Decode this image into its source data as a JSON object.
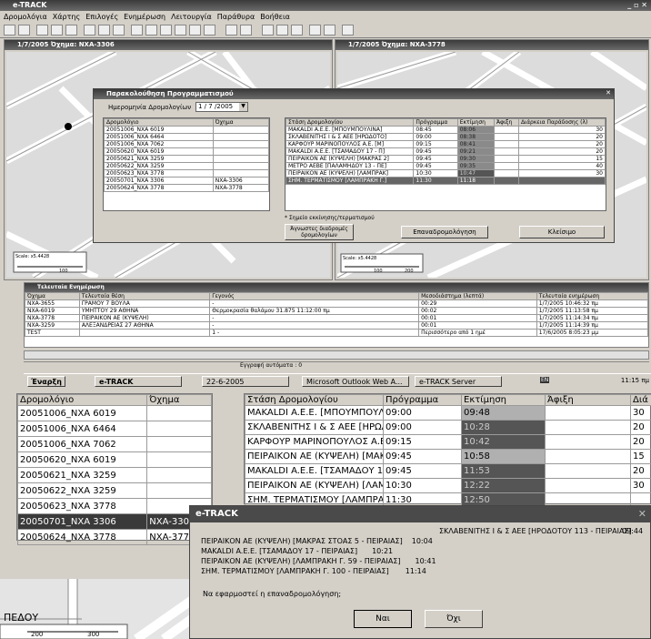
{
  "app": {
    "title": "e-TRACK",
    "menu": [
      "Δρομολόγια",
      "Χάρτης",
      "Επιλογές",
      "Ενημέρωση",
      "Λειτουργία",
      "Παράθυρα",
      "Βοήθεια"
    ]
  },
  "map_left": {
    "title": "1/7/2005 Όχημα: NXA-3306",
    "scale": "Scale: x5.4428",
    "scale_tick": "100"
  },
  "map_right": {
    "title": "1/7/2005 Όχημα: NXA-3778",
    "scale": "Scale: x5.4428",
    "scale_ticks": [
      "100",
      "200"
    ]
  },
  "schedule_dialog": {
    "title": "Παρακολούθηση Προγραμματισμού",
    "date_label": "Ημερομηνία Δρομολογίων",
    "date_value": "1 / 7 /2005",
    "left_headers": [
      "Δρομολόγιο",
      "Όχημα"
    ],
    "left_rows": [
      [
        "20051006_NXA 6019",
        ""
      ],
      [
        "20051006_NXA 6464",
        ""
      ],
      [
        "20051006_NXA 7062",
        ""
      ],
      [
        "20050620_NXA 6019",
        ""
      ],
      [
        "20050621_NXA 3259",
        ""
      ],
      [
        "20050622_NXA 3259",
        ""
      ],
      [
        "20050623_NXA 3778",
        ""
      ],
      [
        "20050701_NXA 3306",
        "NXA-3306"
      ],
      [
        "20050624_NXA 3778",
        "NXA-3778"
      ]
    ],
    "right_headers": [
      "Στάση Δρομολογίου",
      "Πρόγραμμα",
      "Εκτίμηση",
      "Άφιξη",
      "Διάρκεια Παράδοσης (λ)"
    ],
    "right_rows": [
      [
        "MAKALDI A.E.E. [ΜΠΟΥΜΠΟΥΛΙΝΑ]",
        "08:45",
        "08:06",
        "",
        "30"
      ],
      [
        "ΣΚΛΑΒΕΝΙΤΗΣ Ι & Σ ΑΕΕ [ΗΡΩΔΟΤΟ]",
        "09:00",
        "08:38",
        "",
        "20"
      ],
      [
        "ΚΑΡΦΟΥΡ ΜΑΡΙΝΟΠΟΥΛΟΣ Α.Ε. [Μ]",
        "09:15",
        "08:41",
        "",
        "20"
      ],
      [
        "MAKALDI A.E.E. [ΤΣΑΜΑΔΟΥ 17 - Π]",
        "09:45",
        "09:21",
        "",
        "20"
      ],
      [
        "ΠΕΙΡΑΙΚΟΝ ΑΕ (ΚΥΨΕΛΗ) [ΜΑΚΡΑΣ 2]",
        "09:45",
        "09:30",
        "",
        "15"
      ],
      [
        "ΜΕΤΡΟ ΑΕΒΕ [ΠΑΛΑΜΗΔΟΥ 13 - ΠΕ]",
        "09:45",
        "09:35",
        "",
        "40"
      ],
      [
        "ΠΕΙΡΑΙΚΟΝ ΑΕ (ΚΥΨΕΛΗ) [ΛΑΜΠΡΑΚ]",
        "10:30",
        "10:47",
        "",
        "30"
      ],
      [
        "ΣΗΜ. ΤΕΡΜΑΤΙΣΜΟΥ [ΛΑΜΠΡΑΚΗ Γ.]",
        "11:30",
        "11:18",
        "",
        ""
      ]
    ],
    "note": "* Σημείο εκκίνησης/τερματισμού",
    "buttons": [
      "Άγνωστες διαδρομές δρομολογίων",
      "Επαναδρομολόγηση",
      "Κλείσιμο"
    ]
  },
  "latest_panel": {
    "title": "Τελευταία Ενημέρωση",
    "headers": [
      "Όχημα",
      "Τελευταία θέση",
      "Γεγονός",
      "Μεσοδιάστημα (λεπτά)",
      "Τελευταία ενημέρωση"
    ],
    "rows": [
      [
        "NXA-3655",
        "ΓΡΑΜΟΥ 7 ΒΟΥΛΑ",
        "-",
        "00:29",
        "1/7/2005 10:46:32 πμ"
      ],
      [
        "NXA-6019",
        "ΥΜΗΤΤΟΥ 29 ΑΘΗΝΑ",
        "Θερμοκρασία θαλάμου 31.875 11:12:00 πμ",
        "00:02",
        "1/7/2005 11:13:58 πμ"
      ],
      [
        "NXA-3778",
        "ΠΕΙΡΑΙΚΟΝ ΑΕ (ΚΥΨΕΛΗ)",
        "-",
        "00:01",
        "1/7/2005 11:14:34 πμ"
      ],
      [
        "NXA-3259",
        "ΑΛΕΞΑΝΔΡΕΙΑΣ 27 ΑΘΗΝΑ",
        "-",
        "00:01",
        "1/7/2005 11:14:39 πμ"
      ],
      [
        "TEST",
        "",
        "1 -",
        "Περισσότερο από 1 ημέ",
        "17/6/2005 8:05:23 μμ"
      ]
    ]
  },
  "status": {
    "records": "Εγγραφή αυτόματα : 0"
  },
  "taskbar": {
    "start": "Έναρξη",
    "items": [
      "e-TRACK",
      "22-6-2005",
      "Microsoft Outlook Web A...",
      "e-TRACK Server"
    ],
    "clock": "11:15 πμ",
    "lang": "EN"
  },
  "zoom_left": {
    "headers": [
      "Δρομολόγιο",
      "Όχημα"
    ],
    "rows": [
      [
        "20051006_NXA 6019",
        ""
      ],
      [
        "20051006_NXA 6464",
        ""
      ],
      [
        "20051006_NXA 7062",
        ""
      ],
      [
        "20050620_NXA 6019",
        ""
      ],
      [
        "20050621_NXA 3259",
        ""
      ],
      [
        "20050622_NXA 3259",
        ""
      ],
      [
        "20050623_NXA 3778",
        ""
      ],
      [
        "20050701_NXA 3306",
        "NXA-3306"
      ],
      [
        "20050624_NXA 3778",
        "NXA-3778"
      ]
    ]
  },
  "zoom_right": {
    "headers": [
      "Στάση Δρομολογίου",
      "Πρόγραμμα",
      "Εκτίμηση",
      "Άφιξη",
      "Διά"
    ],
    "rows": [
      [
        "MAKALDI A.E.E. [ΜΠΟΥΜΠΟΥΛΙΝΑ",
        "09:00",
        "09:48",
        "",
        "30"
      ],
      [
        "ΣΚΛΑΒΕΝΙΤΗΣ Ι & Σ ΑΕΕ [ΗΡΩΔΟΤΟ",
        "09:00",
        "10:28",
        "",
        "20"
      ],
      [
        "ΚΑΡΦΟΥΡ ΜΑΡΙΝΟΠΟΥΛΟΣ Α.Ε. [Μ",
        "09:15",
        "10:42",
        "",
        "20"
      ],
      [
        "ΠΕΙΡΑΙΚΟΝ ΑΕ (ΚΥΨΕΛΗ) [ΜΑΚΡΑΣ",
        "09:45",
        "10:58",
        "",
        "15"
      ],
      [
        "MAKALDI A.E.E. [ΤΣΑΜΑΔΟΥ 17 -",
        "09:45",
        "11:53",
        "",
        "20"
      ],
      [
        "ΠΕΙΡΑΙΚΟΝ ΑΕ (ΚΥΨΕΛΗ) [ΛΑΜΠΡΑ",
        "10:30",
        "12:22",
        "",
        "30"
      ],
      [
        "ΣΗΜ. ΤΕΡΜΑΤΙΣΜΟΥ [ΛΑΜΠΡΑΚΗ Γ",
        "11:30",
        "12:50",
        "",
        ""
      ]
    ]
  },
  "confirm": {
    "title": "e-TRACK",
    "lines": [
      [
        "ΣΚΛΑΒΕΝΙΤΗΣ Ι & Σ ΑΕΕ [ΗΡΟΔΟΤΟΥ 113 - ΠΕΙΡΑΙΑΣ]",
        "09:44"
      ],
      [
        "ΠΕΙΡΑΙΚΟΝ ΑΕ (ΚΥΨΕΛΗ) [ΜΑΚΡΑΣ ΣΤΟΑΣ 5 - ΠΕΙΡΑΙΑΣ]",
        "10:04"
      ],
      [
        "MAKALDI A.E.E. [ΤΣΑΜΑΔΟΥ 17 - ΠΕΙΡΑΙΑΣ]",
        "10:21"
      ],
      [
        "ΠΕΙΡΑΙΚΟΝ ΑΕ (ΚΥΨΕΛΗ) [ΛΑΜΠΡΑΚΗ Γ. 59 - ΠΕΙΡΑΙΑΣ]",
        "10:41"
      ],
      [
        "ΣΗΜ. ΤΕΡΜΑΤΙΣΜΟΥ [ΛΑΜΠΡΑΚΗ Γ. 100 - ΠΕΙΡΑΙΑΣ]",
        "11:14"
      ]
    ],
    "question": "Να εφαρμοστεί η επαναδρομολόγηση;",
    "yes": "Ναι",
    "no": "Όχι"
  },
  "zoom_map": {
    "street": "ΠΕΔΟΥ",
    "ticks": [
      "200",
      "300"
    ]
  }
}
